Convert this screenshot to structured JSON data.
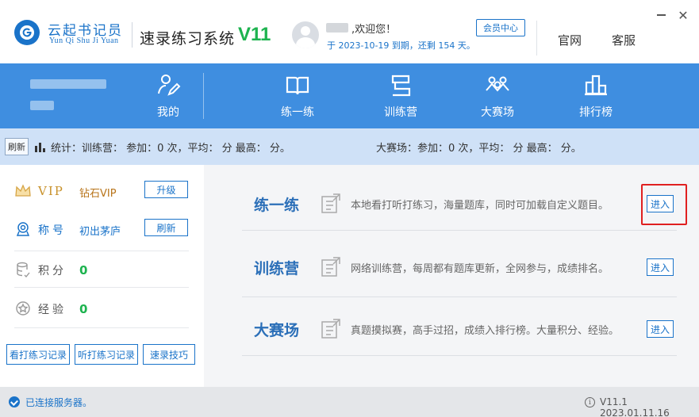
{
  "header": {
    "brand_cn": "云起书记员",
    "brand_en": "Yun Qi Shu Ji Yuan",
    "system_title": "速录练习系统",
    "version_badge": "V11",
    "welcome": ",欢迎您！",
    "expiry": "于 2023-10-19 到期，还剩 154 天。",
    "member_center": "会员中心",
    "official_site": "官网",
    "customer_service": "客服",
    "brand_color": "#1a73c9",
    "version_color": "#1db34f"
  },
  "nav": {
    "bg_color": "#3f8ee0",
    "items": [
      {
        "label": "我的",
        "icon": "user-edit-icon"
      },
      {
        "label": "练一练",
        "icon": "book-icon"
      },
      {
        "label": "训练营",
        "icon": "tent-icon"
      },
      {
        "label": "大赛场",
        "icon": "people-icon"
      },
      {
        "label": "排行榜",
        "icon": "ranking-icon"
      }
    ]
  },
  "stats": {
    "refresh": "刷新",
    "training": "统计：训练营：  参加：0 次，平均：  分 最高：  分。",
    "contest": "大赛场：参加：0 次，平均：  分 最高：  分。"
  },
  "profile": {
    "vip_label": "VIP",
    "vip_value": "钻石VIP",
    "upgrade_button": "升级",
    "title_label": "称号",
    "title_value": "初出茅庐",
    "refresh_button": "刷新",
    "points_label": "积分",
    "points_value": "0",
    "exp_label": "经验",
    "exp_value": "0",
    "buttons": [
      "看打练习记录",
      "听打练习记录",
      "速录技巧"
    ]
  },
  "modes": [
    {
      "title": "练一练",
      "desc": "本地看打听打练习，海量题库，同时可加载自定义题目。",
      "button": "进入"
    },
    {
      "title": "训练营",
      "desc": "网络训练营，每周都有题库更新，全网参与，成绩排名。",
      "button": "进入"
    },
    {
      "title": "大赛场",
      "desc": "真题摸拟赛，高手过招，成绩入排行榜。大量积分、经验。",
      "button": "进入"
    }
  ],
  "status": {
    "connected": "已连接服务器。",
    "version": "V11.1 2023.01.11.16"
  }
}
